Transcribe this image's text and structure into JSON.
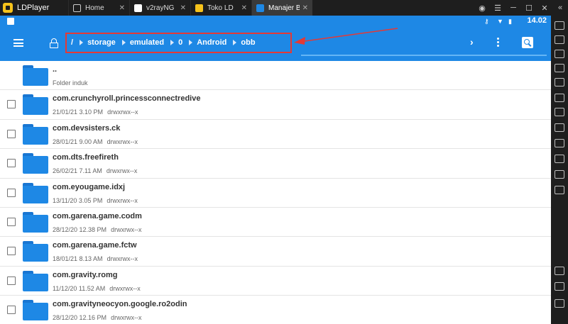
{
  "emulator": {
    "app_name": "LDPlayer",
    "tabs": [
      {
        "label": "Home",
        "icon": "home-icon",
        "color": "#2b2b2b",
        "active": false
      },
      {
        "label": "v2rayNG",
        "icon": "v2rayng-icon",
        "color": "#ffffff",
        "active": false
      },
      {
        "label": "Toko LD",
        "icon": "toko-ld-icon",
        "color": "#f7c31b",
        "active": false
      },
      {
        "label": "Manajer Berk…",
        "icon": "file-manager-icon",
        "color": "#1e88e5",
        "active": true
      }
    ],
    "window_controls": [
      "gamepad-icon",
      "menu-icon",
      "minimize-icon",
      "maximize-icon",
      "close-icon",
      "expand-icon"
    ]
  },
  "statusbar": {
    "time": "14.02",
    "icons": [
      "key-icon",
      "wifi-icon",
      "battery-icon"
    ]
  },
  "toolbar": {
    "accent": "#1e88e5",
    "breadcrumb": [
      "/",
      "storage",
      "emulated",
      "0",
      "Android",
      "obb"
    ]
  },
  "files": [
    {
      "name": "..",
      "date": "Folder induk",
      "perm": "",
      "parent": true
    },
    {
      "name": "com.crunchyroll.princessconnectredive",
      "date": "21/01/21 3.10 PM",
      "perm": "drwxrwx--x"
    },
    {
      "name": "com.devsisters.ck",
      "date": "28/01/21 9.00 AM",
      "perm": "drwxrwx--x"
    },
    {
      "name": "com.dts.freefireth",
      "date": "26/02/21 7.11 AM",
      "perm": "drwxrwx--x"
    },
    {
      "name": "com.eyougame.idxj",
      "date": "13/11/20 3.05 PM",
      "perm": "drwxrwx--x"
    },
    {
      "name": "com.garena.game.codm",
      "date": "28/12/20 12.38 PM",
      "perm": "drwxrwx--x"
    },
    {
      "name": "com.garena.game.fctw",
      "date": "18/01/21 8.13 AM",
      "perm": "drwxrwx--x"
    },
    {
      "name": "com.gravity.romg",
      "date": "11/12/20 11.52 AM",
      "perm": "drwxrwx--x"
    },
    {
      "name": "com.gravityneocyon.google.ro2odin",
      "date": "28/12/20 12.16 PM",
      "perm": "drwxrwx--x"
    }
  ]
}
